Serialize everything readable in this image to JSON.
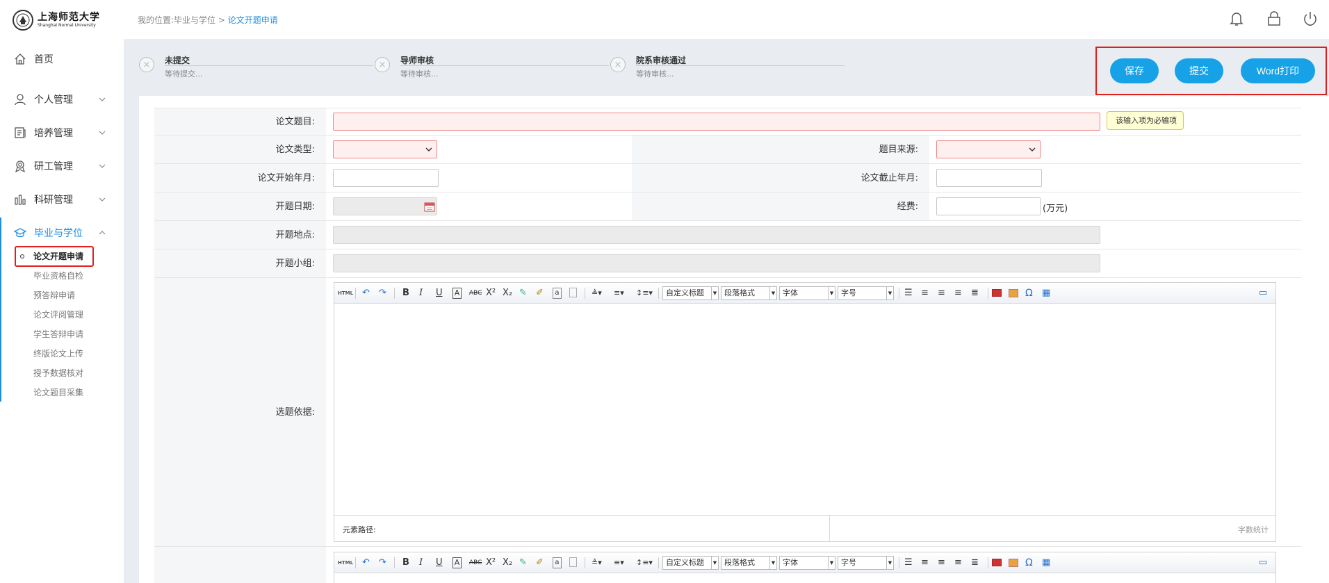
{
  "sidebar": {
    "logo_cn": "上海师范大学",
    "logo_en": "Shanghai Normal University",
    "items": [
      {
        "label": "首页",
        "icon": "home-icon"
      },
      {
        "label": "个人管理",
        "icon": "user-icon"
      },
      {
        "label": "培养管理",
        "icon": "document-icon"
      },
      {
        "label": "研工管理",
        "icon": "award-icon"
      },
      {
        "label": "科研管理",
        "icon": "bar-chart-icon"
      },
      {
        "label": "毕业与学位",
        "icon": "graduation-cap-icon"
      }
    ],
    "sub_items": [
      "论文开题申请",
      "毕业资格自检",
      "预答辩申请",
      "论文评阅管理",
      "学生答辩申请",
      "终版论文上传",
      "授予数据核对",
      "论文题目采集"
    ]
  },
  "header": {
    "breadcrumb_prefix": "我的位置:毕业与学位",
    "breadcrumb_sep": ">",
    "breadcrumb_current": "论文开题申请",
    "icons": [
      "bell-icon",
      "lock-icon",
      "power-icon"
    ]
  },
  "steps": [
    {
      "title": "未提交",
      "desc": "等待提交..."
    },
    {
      "title": "导师审核",
      "desc": "等待审核..."
    },
    {
      "title": "院系审核通过",
      "desc": "等待审核..."
    }
  ],
  "actions": {
    "save": "保存",
    "submit": "提交",
    "print": "Word打印"
  },
  "form": {
    "title_label": "论文题目:",
    "title_value": "",
    "required_tip": "该输入项为必输项",
    "type_label": "论文类型:",
    "source_label": "题目来源:",
    "start_label": "论文开始年月:",
    "end_label": "论文截止年月:",
    "open_date_label": "开题日期:",
    "funds_label": "经费:",
    "funds_unit": "(万元)",
    "place_label": "开题地点:",
    "group_label": "开题小组:",
    "basis_label": "选题依据:"
  },
  "editor": {
    "html_label": "HTML",
    "title_select": "自定义标题",
    "para_select": "段落格式",
    "font_select": "字体",
    "size_select": "字号",
    "path_label": "元素路径:",
    "word_count": "字数统计"
  },
  "colors": {
    "accent": "#17a2e8",
    "highlight": "#e0201c",
    "required_bg": "#fff0f0"
  }
}
